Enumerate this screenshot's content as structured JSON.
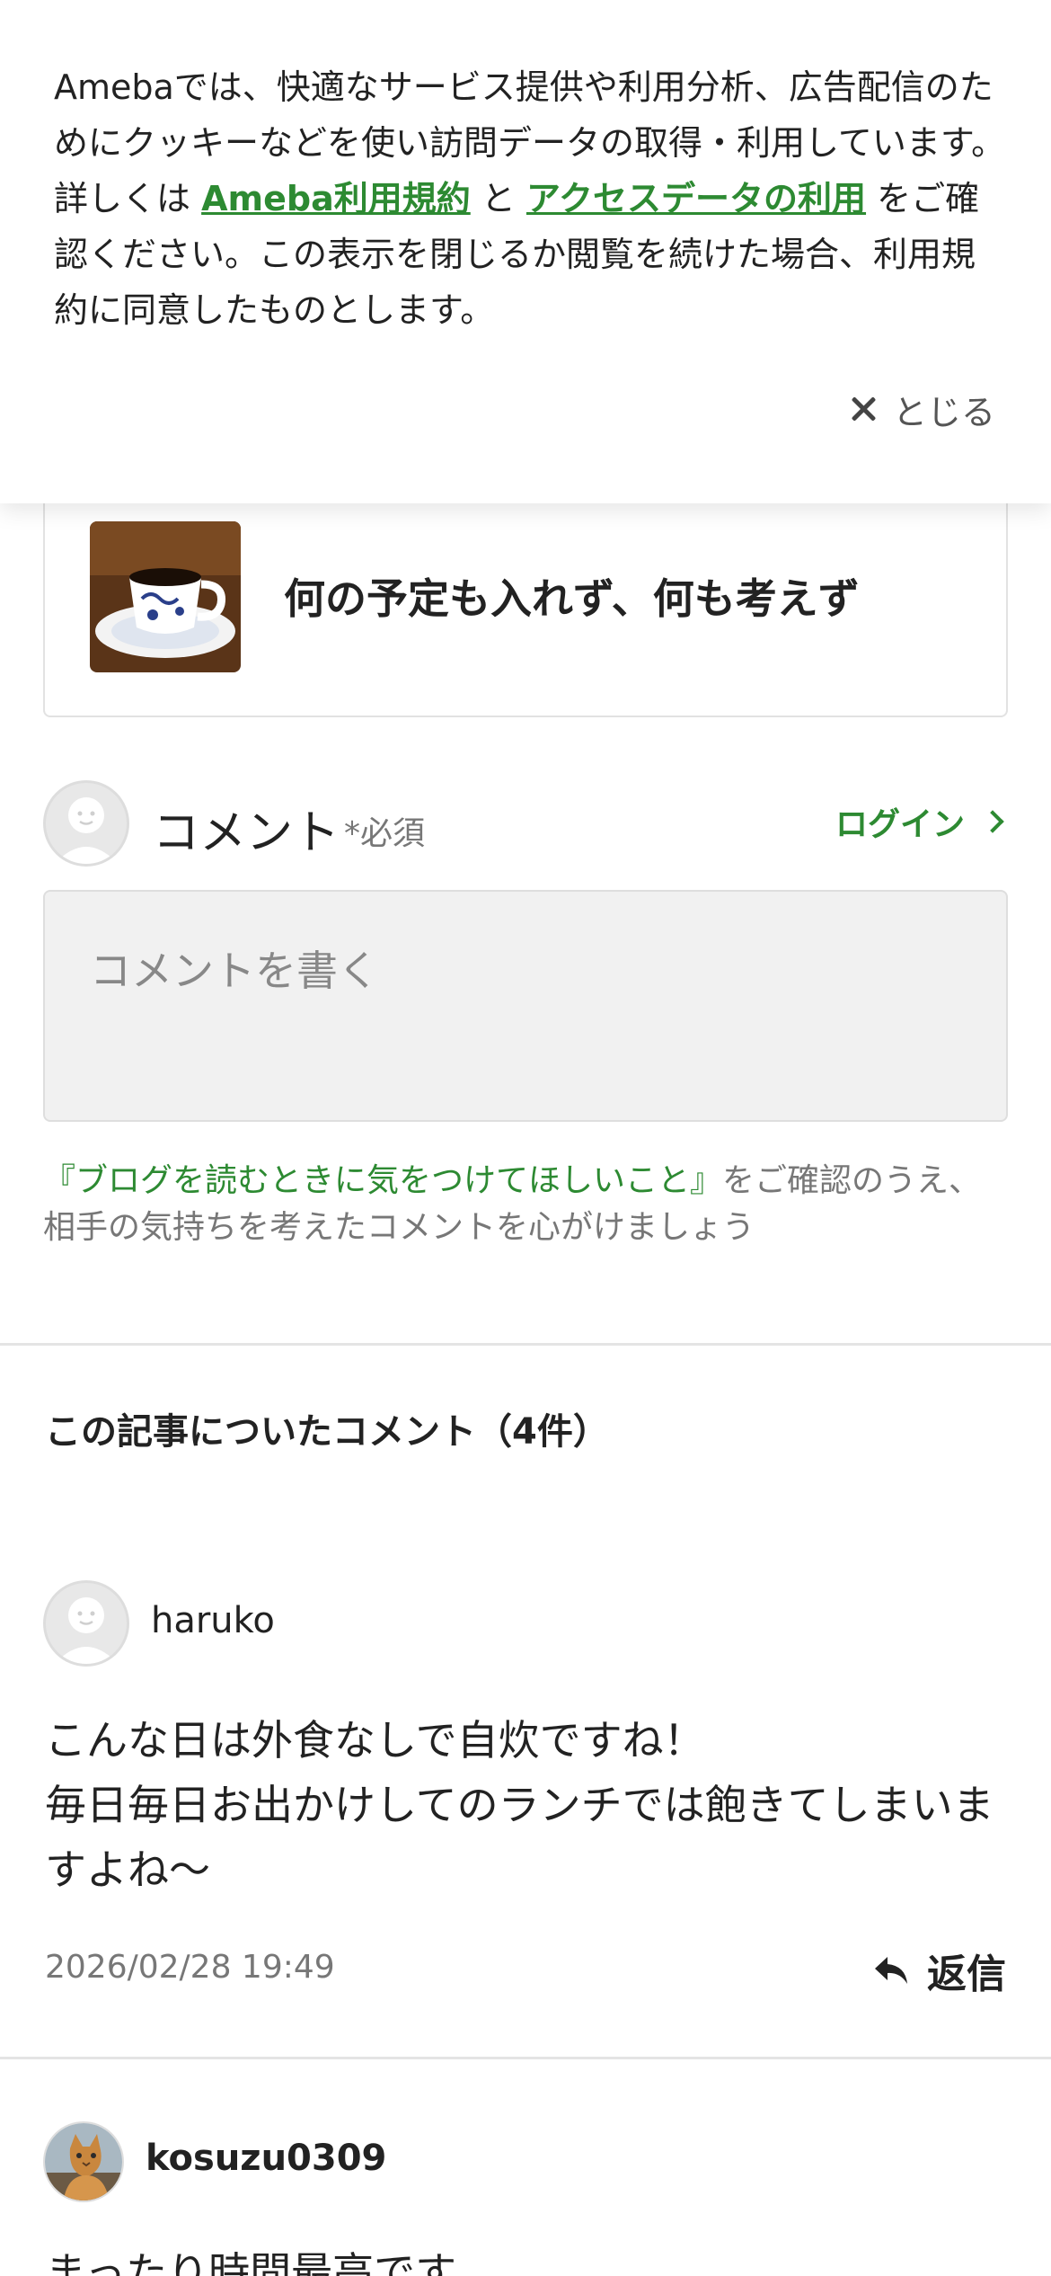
{
  "cookie_banner": {
    "text_1": "Amebaでは、快適なサービス提供や利用分析、広告配信のためにクッキーなどを使い訪問データの取得・利用しています。詳しくは",
    "link_terms": "Ameba利用規約",
    "connector": "と",
    "link_access": "アクセスデータの利用",
    "text_2": "をご確認ください。この表示を閉じるか閲覧を続けた場合、利用規約に同意したものとします。",
    "close_label": "とじる",
    "close_icon": "close-icon"
  },
  "post_card": {
    "title": "何の予定も入れず、何も考えず",
    "thumbnail_icon": "coffee-cup-photo"
  },
  "comment_form": {
    "label": "コメント",
    "required": "*必須",
    "login_label": "ログイン",
    "placeholder": "コメントを書く",
    "guideline_link": "『ブログを読むときに気をつけてほしいこと』",
    "guideline_text": "をご確認のうえ、相手の気持ちを考えたコメントを心がけましょう"
  },
  "comments_section": {
    "heading": "この記事についたコメント（4件）"
  },
  "comments": [
    {
      "author": "haruko",
      "body_line1": "こんな日は外食なしで自炊ですね！",
      "body_line2": "毎日毎日お出かけしてのランチでは飽きてしまいますよね〜",
      "date": "2026/02/28 19:49",
      "reply_label": "返信"
    },
    {
      "author": "kosuzu0309",
      "body_line1": "まったり時間最高です"
    }
  ],
  "colors": {
    "accent_green": "#2d8a32",
    "divider": "#e4e4e4",
    "input_bg": "#f1f1f1"
  }
}
